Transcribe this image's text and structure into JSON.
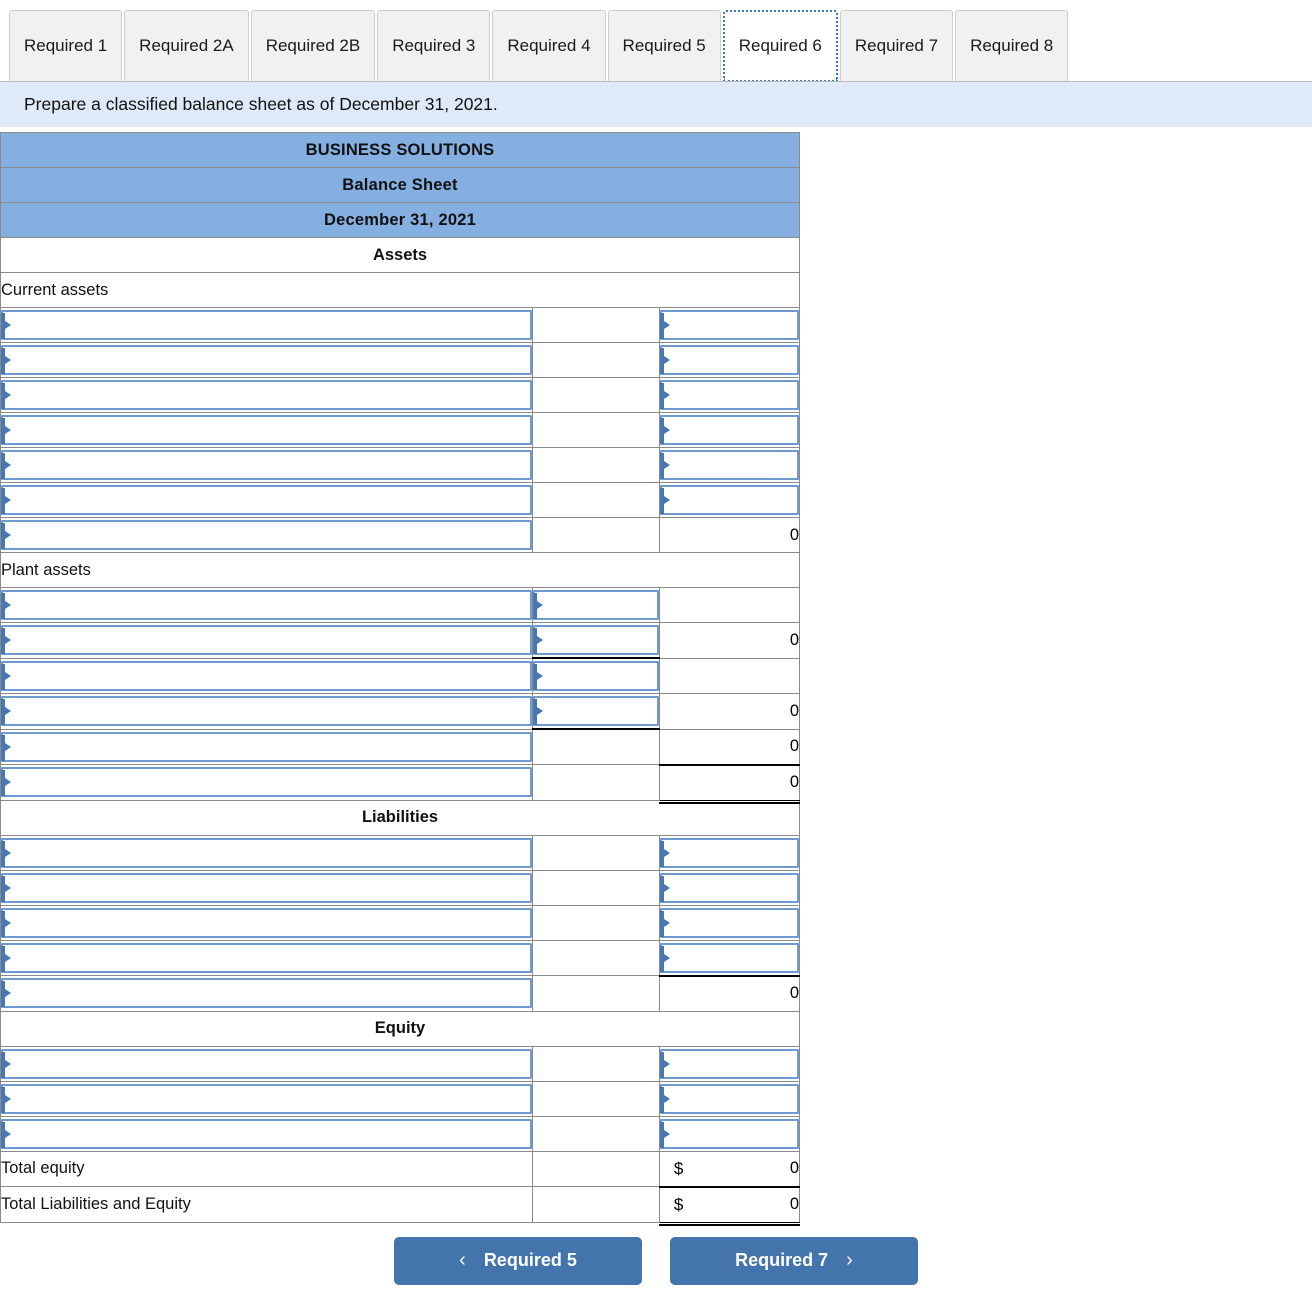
{
  "tabs": [
    {
      "label": "Required 1",
      "active": false
    },
    {
      "label": "Required 2A",
      "active": false
    },
    {
      "label": "Required 2B",
      "active": false
    },
    {
      "label": "Required 3",
      "active": false
    },
    {
      "label": "Required 4",
      "active": false
    },
    {
      "label": "Required 5",
      "active": false
    },
    {
      "label": "Required 6",
      "active": true
    },
    {
      "label": "Required 7",
      "active": false
    },
    {
      "label": "Required 8",
      "active": false
    }
  ],
  "instruction": {
    "text": "Prepare a classified balance sheet as of December 31, 2021."
  },
  "sheet": {
    "company": "BUSINESS SOLUTIONS",
    "statement": "Balance Sheet",
    "date": "December 31, 2021",
    "sections": {
      "assets_header": "Assets",
      "liabilities_header": "Liabilities",
      "equity_header": "Equity",
      "current_assets_label": "Current assets",
      "plant_assets_label": "Plant assets"
    },
    "current_assets_rows": [
      {
        "select1": "",
        "col2": "",
        "select3": true,
        "col3": ""
      },
      {
        "select1": "",
        "col2": "",
        "select3": true,
        "col3": ""
      },
      {
        "select1": "",
        "col2": "",
        "select3": true,
        "col3": ""
      },
      {
        "select1": "",
        "col2": "",
        "select3": true,
        "col3": ""
      },
      {
        "select1": "",
        "col2": "",
        "select3": true,
        "col3": ""
      },
      {
        "select1": "",
        "col2": "",
        "select3": true,
        "col3": ""
      },
      {
        "select1": "",
        "col2": "",
        "select3": false,
        "col3": "0"
      }
    ],
    "plant_assets_rows": [
      {
        "select1": true,
        "select2": true,
        "col3": "",
        "underline3": false
      },
      {
        "select1": true,
        "select2": true,
        "col3": "0",
        "underline3": false
      },
      {
        "select1": true,
        "select2": true,
        "col3": "",
        "underline3": false
      },
      {
        "select1": true,
        "select2": true,
        "col3": "0",
        "underline3": false
      },
      {
        "select1": true,
        "select2": false,
        "col3": "0",
        "underline3": false
      },
      {
        "select1": true,
        "select2": false,
        "col3": "0",
        "underline3": true
      }
    ],
    "liabilities_rows": [
      {
        "select1": true,
        "select3": true,
        "col3": ""
      },
      {
        "select1": true,
        "select3": true,
        "col3": ""
      },
      {
        "select1": true,
        "select3": true,
        "col3": ""
      },
      {
        "select1": true,
        "select3": true,
        "col3": ""
      },
      {
        "select1": true,
        "select3": false,
        "col3": "0"
      }
    ],
    "equity_rows": [
      {
        "select1": true,
        "select3": true,
        "col3": ""
      },
      {
        "select1": true,
        "select3": true,
        "col3": ""
      },
      {
        "select1": true,
        "select3": true,
        "col3": ""
      }
    ],
    "totals": [
      {
        "label": "Total equity",
        "dollar": "$",
        "value": "0",
        "double_underline": false
      },
      {
        "label": "Total Liabilities and Equity",
        "dollar": "$",
        "value": "0",
        "double_underline": true
      }
    ]
  },
  "nav": {
    "prev_label": "Required 5",
    "prev_chevron": "‹",
    "next_label": "Required 7",
    "next_chevron": "›"
  },
  "colors": {
    "header_blue": "#85AFE0",
    "banner_blue": "#DEEAF7",
    "button_blue": "#4374AC",
    "input_border": "#6F9AD1",
    "input_arrow": "#4878B4"
  }
}
